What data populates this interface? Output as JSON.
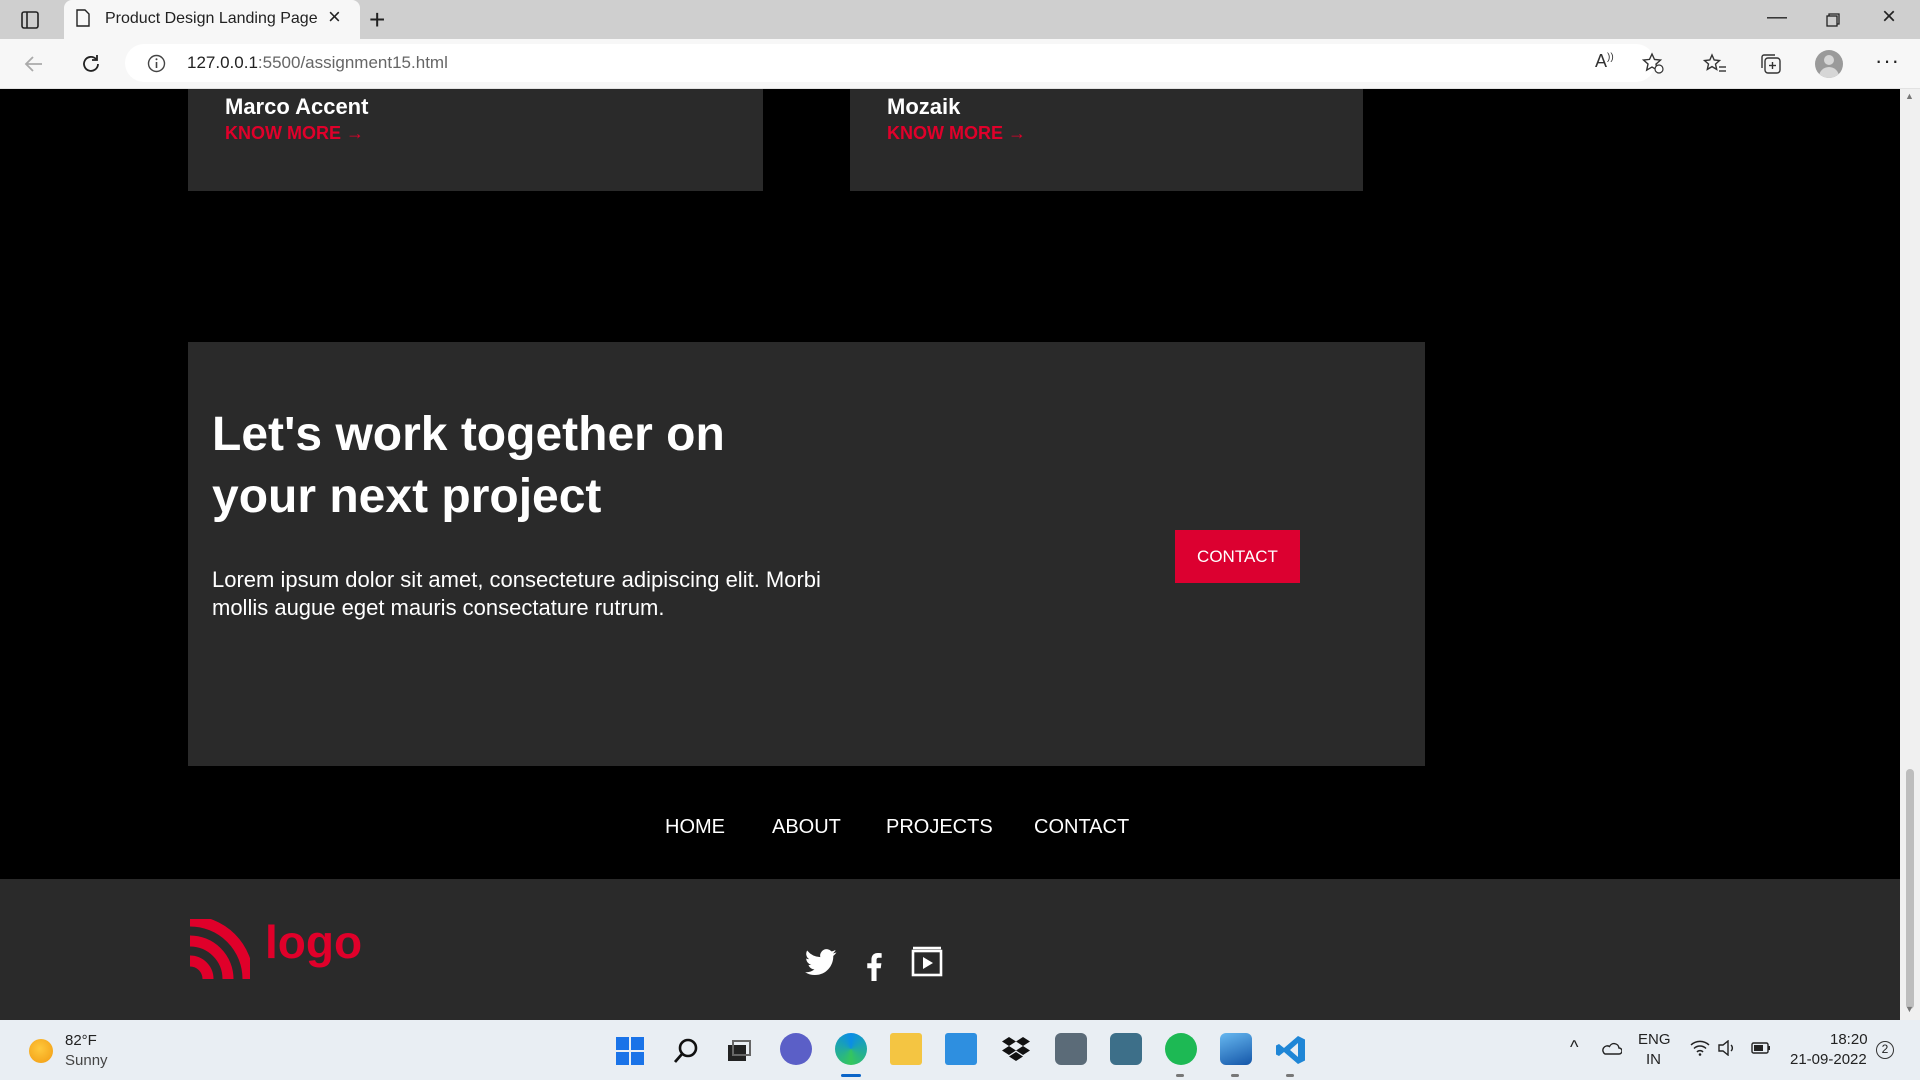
{
  "browser": {
    "tab_title": "Product Design Landing Page",
    "url_host": "127.0.0.1",
    "url_path": ":5500/assignment15.html"
  },
  "cards": [
    {
      "title": "Marco Accent",
      "link": "KNOW MORE"
    },
    {
      "title": "Mozaik",
      "link": "KNOW MORE"
    }
  ],
  "cta": {
    "heading": "Let's work together on your next project",
    "body": "Lorem ipsum dolor sit amet, consecteture adipiscing elit. Morbi mollis augue eget mauris consectature rutrum.",
    "button": "CONTACT"
  },
  "nav": {
    "items": [
      "HOME",
      "ABOUT",
      "PROJECTS",
      "CONTACT"
    ]
  },
  "footer": {
    "logo_text": "logo",
    "social": [
      "twitter-icon",
      "facebook-icon",
      "youtube-icon"
    ]
  },
  "taskbar": {
    "weather_temp": "82°F",
    "weather_condition": "Sunny",
    "language_1": "ENG",
    "language_2": "IN",
    "time": "18:20",
    "date": "21-09-2022",
    "notification_count": "2"
  },
  "colors": {
    "accent": "#dc0030",
    "card_bg": "#2a2a2a",
    "page_bg": "#000000"
  }
}
